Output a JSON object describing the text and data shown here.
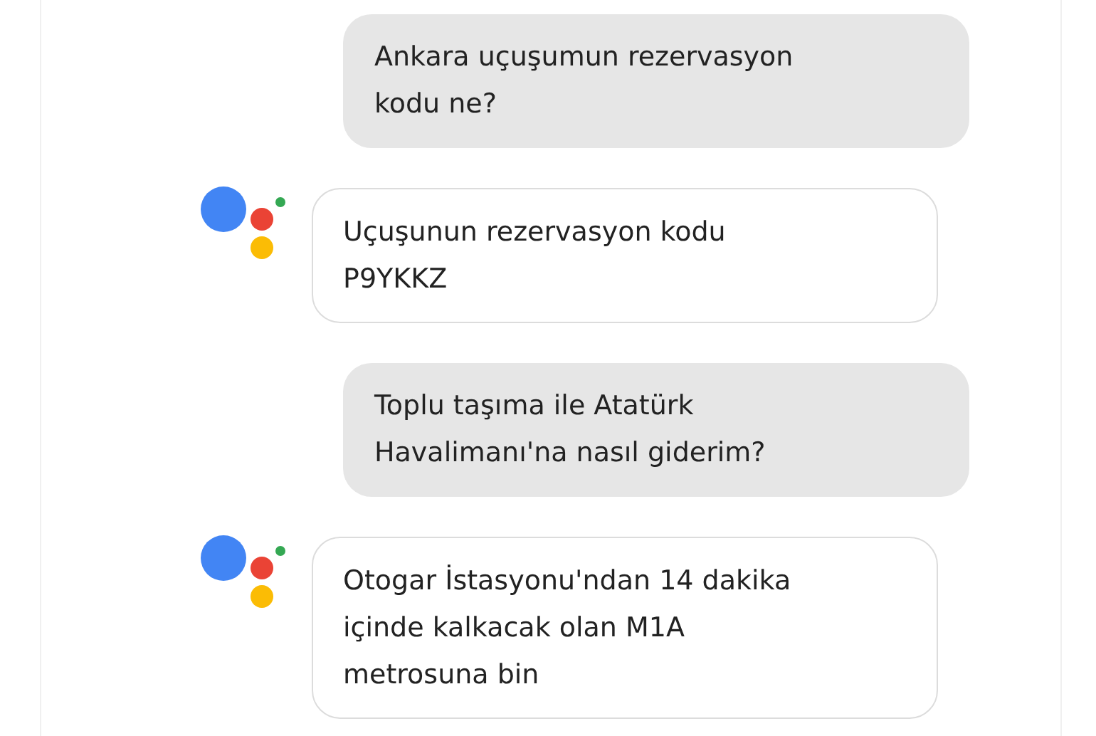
{
  "messages": [
    {
      "kind": "user",
      "text": "Ankara uçuşumun rezervasyon\nkodu ne?"
    },
    {
      "kind": "assistant",
      "text": "Uçuşunun rezervasyon kodu\nP9YKKZ"
    },
    {
      "kind": "user",
      "text": "Toplu taşıma ile Atatürk\nHavalimanı'na nasıl giderim?"
    },
    {
      "kind": "assistant",
      "text": "Otogar İstasyonu'ndan 14 dakika\niçinde kalkacak olan M1A\nmetrosuna bin"
    }
  ]
}
